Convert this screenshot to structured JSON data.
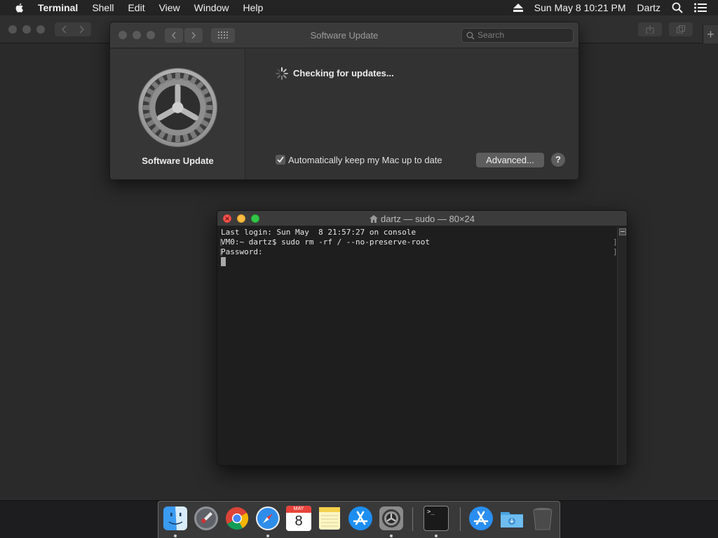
{
  "menubar": {
    "app_name": "Terminal",
    "items": [
      "Shell",
      "Edit",
      "View",
      "Window",
      "Help"
    ],
    "clock": "Sun May 8  10:21 PM",
    "user": "Dartz"
  },
  "software_update": {
    "window_title": "Software Update",
    "search_placeholder": "Search",
    "pane_label": "Software Update",
    "status": "Checking for updates...",
    "auto_update_label": "Automatically keep my Mac up to date",
    "auto_update_checked": true,
    "advanced_button": "Advanced...",
    "help_button": "?"
  },
  "terminal": {
    "title": "dartz — sudo — 80×24",
    "lines": [
      "Last login: Sun May  8 21:57:27 on console",
      "VM0:~ dartz$ sudo rm -rf / --no-preserve-root",
      "Password:"
    ]
  },
  "dock": {
    "calendar_month": "MAY",
    "calendar_day": "8",
    "terminal_prompt": ">_"
  }
}
